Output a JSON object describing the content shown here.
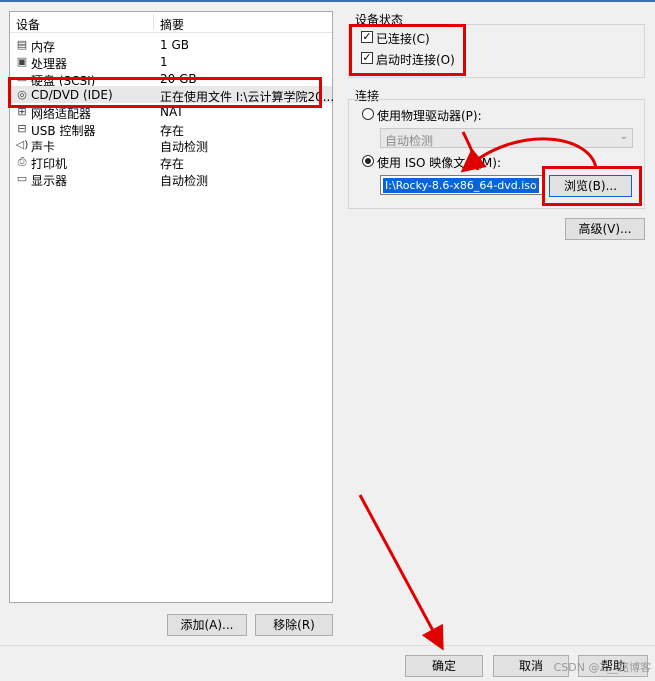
{
  "device_list": {
    "col_device": "设备",
    "col_summary": "摘要",
    "items": [
      {
        "name": "内存",
        "summary": "1 GB",
        "icon": "memory-icon"
      },
      {
        "name": "处理器",
        "summary": "1",
        "icon": "cpu-icon"
      },
      {
        "name": "硬盘 (SCSI)",
        "summary": "20 GB",
        "icon": "disk-icon"
      },
      {
        "name": "CD/DVD (IDE)",
        "summary": "正在使用文件 I:\\云计算学院20...",
        "icon": "cd-icon"
      },
      {
        "name": "网络适配器",
        "summary": "NAT",
        "icon": "network-icon"
      },
      {
        "name": "USB 控制器",
        "summary": "存在",
        "icon": "usb-icon"
      },
      {
        "name": "声卡",
        "summary": "自动检测",
        "icon": "speaker-icon"
      },
      {
        "name": "打印机",
        "summary": "存在",
        "icon": "printer-icon"
      },
      {
        "name": "显示器",
        "summary": "自动检测",
        "icon": "monitor-icon"
      }
    ],
    "add_button": "添加(A)...",
    "remove_button": "移除(R)"
  },
  "device_status": {
    "title": "设备状态",
    "connected": "已连接(C)",
    "connect_on_power": "启动时连接(O)"
  },
  "connection": {
    "title": "连接",
    "physical_drive": "使用物理驱动器(P):",
    "physical_drive_value": "自动检测",
    "iso_file": "使用 ISO 映像文件(M):",
    "iso_value": "I:\\Rocky-8.6-x86_64-dvd.iso",
    "browse_button": "浏览(B)...",
    "advanced_button": "高级(V)..."
  },
  "footer": {
    "ok": "确定",
    "cancel": "取消",
    "help": "帮助",
    "watermark": "CSDN @Z__铭博客"
  },
  "colors": {
    "annotation_red": "#e00000",
    "selection_blue": "#0a64d8"
  }
}
